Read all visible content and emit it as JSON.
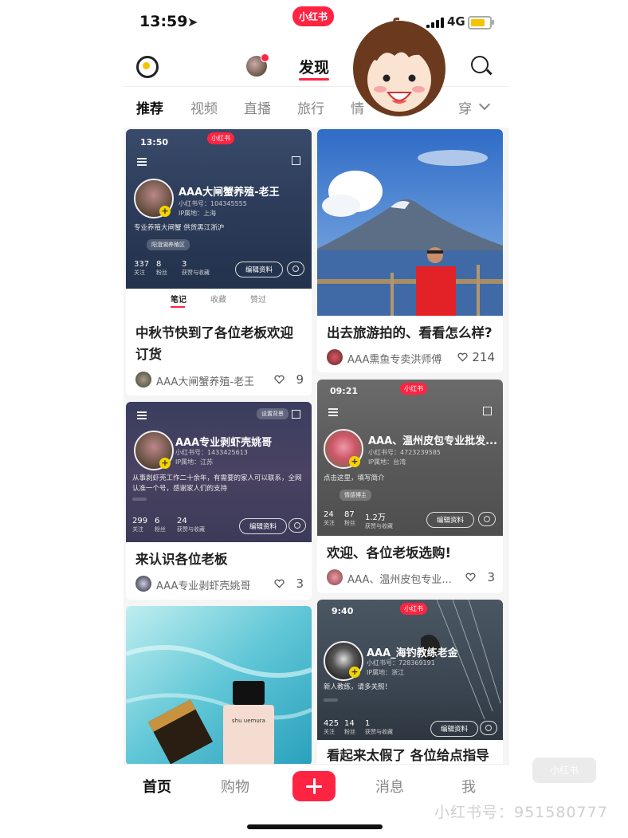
{
  "status": {
    "time": "13:59",
    "brand": "小红书",
    "network": "4G",
    "battery_level": 0.75
  },
  "nav": {
    "title": "发现"
  },
  "channels": [
    "推荐",
    "视频",
    "直播",
    "旅行",
    "情",
    "穿"
  ],
  "cards": [
    {
      "title": "中秋节快到了各位老板欢迎订货",
      "author": "AAA大闸蟹养殖-老王",
      "likes": "9",
      "profile": {
        "time": "13:50",
        "brand": "小红书",
        "name": "AAA大闸蟹养殖-老王",
        "id": "小红书号：104345555 ",
        "loc": "IP属地：上海",
        "bio": "专业养殖大闸蟹 供货黑江浙沪",
        "tag": "阳澄湖养殖区",
        "stats": [
          {
            "n": "337",
            "l": "关注"
          },
          {
            "n": "8",
            "l": "粉丝"
          },
          {
            "n": "3",
            "l": "获赞与收藏"
          }
        ],
        "edit": "编辑资料",
        "tabs": [
          "笔记",
          "收藏",
          "赞过"
        ]
      }
    },
    {
      "title": "出去旅游拍的、看看怎么样?",
      "author": "AAA熏鱼专卖洪师傅",
      "likes": "214"
    },
    {
      "title": "来认识各位老板",
      "author": "AAA专业剥虾壳姚哥",
      "likes": "3",
      "profile": {
        "name": "AAA专业剥虾壳姚哥",
        "id": "小红书号：1433425613",
        "loc": "IP属地：江苏",
        "bio": "从事剥虾壳工作二十余年，有需要的家人可以联系，全网认准一个号，感谢家人们的支持",
        "stats": [
          {
            "n": "299",
            "l": "关注"
          },
          {
            "n": "6",
            "l": "粉丝"
          },
          {
            "n": "24",
            "l": "获赞与收藏"
          }
        ],
        "edit": "编辑资料",
        "badge": "设置背景"
      }
    },
    {
      "title": "欢迎、各位老坂选购!",
      "author": "AAA、温州皮包专业...",
      "likes": "3",
      "profile": {
        "time": "09:21",
        "brand": "小红书",
        "name": "AAA、温州皮包专业批发...",
        "id": "小红书号：4723239585",
        "loc": "IP属地：台湾",
        "bio": "点击这里，填写简介",
        "tag": "情感博主",
        "stats": [
          {
            "n": "24",
            "l": "关注"
          },
          {
            "n": "87",
            "l": "粉丝"
          },
          {
            "n": "1.2万",
            "l": "获赞与收藏"
          }
        ],
        "edit": "编辑资料"
      }
    },
    {
      "title": "",
      "author": "",
      "likes": "",
      "product": "shu uemura"
    },
    {
      "title": "看起来太假了 各位给点指导",
      "author": "",
      "likes": "",
      "profile": {
        "time": "9:40",
        "brand": "小红书",
        "name": "AAA_海钓教练老金",
        "id": "小红书号：728369191",
        "loc": "IP属地：浙江",
        "bio": "新人教练，请多关照！",
        "stats": [
          {
            "n": "425",
            "l": "关注"
          },
          {
            "n": "14",
            "l": "粉丝"
          },
          {
            "n": "1",
            "l": "获赞与收藏"
          }
        ],
        "edit": "编辑资料"
      }
    }
  ],
  "bottom": {
    "home": "首页",
    "shop": "购物",
    "messages": "消息",
    "me": "我"
  },
  "watermark": "小红书号：951580777",
  "watermark_logo": "小红书",
  "colors": {
    "brand_red": "#ff2442",
    "yellow": "#f5d300"
  }
}
